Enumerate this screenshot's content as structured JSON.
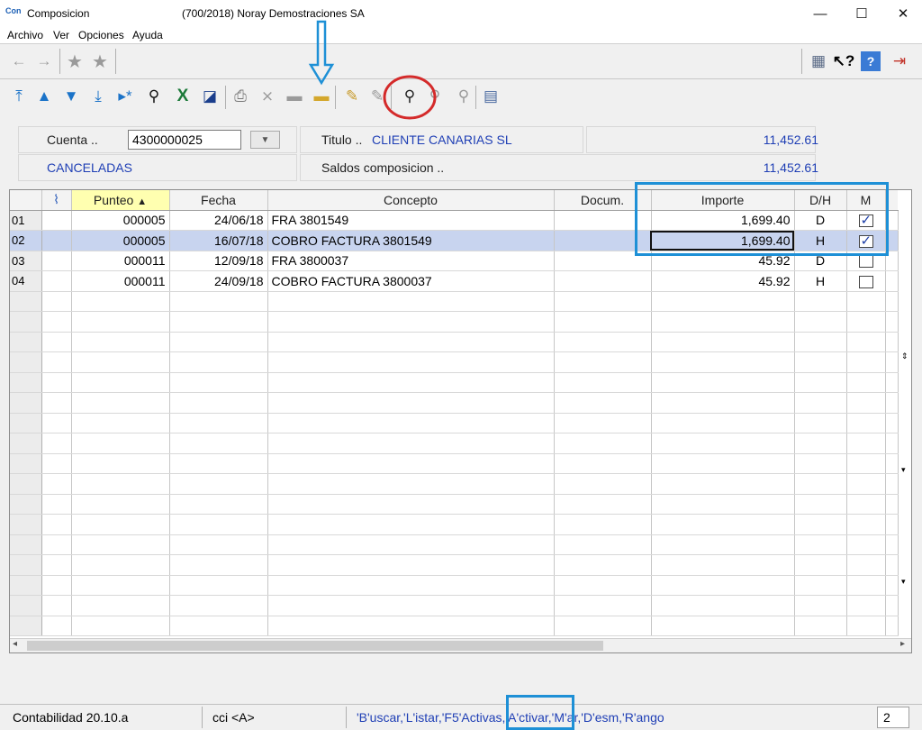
{
  "window": {
    "app_icon": "Con",
    "title": "Composicion",
    "company": "(700/2018) Noray Demostraciones SA",
    "minimize": "—",
    "maximize": "☐",
    "close": "✕"
  },
  "menu": [
    {
      "label": "Archivo"
    },
    {
      "label": "Ver"
    },
    {
      "label": "Opciones"
    },
    {
      "label": "Ayuda"
    }
  ],
  "header": {
    "cuenta_label": "Cuenta ..",
    "cuenta_value": "4300000025",
    "titulo_label": "Titulo ..",
    "titulo_value": "CLIENTE CANARIAS SL",
    "titulo_amount": "11,452.61",
    "estado": "CANCELADAS",
    "saldos_label": "Saldos composicion ..",
    "saldos_amount": "11,452.61"
  },
  "grid": {
    "columns": [
      "",
      "",
      "Punteo",
      "Fecha",
      "Concepto",
      "Docum.",
      "Importe",
      "D/H",
      "M"
    ],
    "sort_indicator": "▲",
    "rows": [
      {
        "num": "01",
        "punteo": "000005",
        "fecha": "24/06/18",
        "concepto": "FRA 3801549",
        "docum": "",
        "importe": "1,699.40",
        "dh": "D",
        "m": true
      },
      {
        "num": "02",
        "punteo": "000005",
        "fecha": "16/07/18",
        "concepto": "COBRO FACTURA 3801549",
        "docum": "",
        "importe": "1,699.40",
        "dh": "H",
        "m": true
      },
      {
        "num": "03",
        "punteo": "000011",
        "fecha": "12/09/18",
        "concepto": "FRA 3800037",
        "docum": "",
        "importe": "45.92",
        "dh": "D",
        "m": false
      },
      {
        "num": "04",
        "punteo": "000011",
        "fecha": "24/09/18",
        "concepto": "COBRO FACTURA 3800037",
        "docum": "",
        "importe": "45.92",
        "dh": "H",
        "m": false
      }
    ],
    "empty_rows": 17,
    "selected_row": 1
  },
  "status": {
    "version": "Contabilidad 20.10.a",
    "user": "cci <A>",
    "hint": "'B'uscar,'L'istar,'F5'Activas,'A'ctivar,'M'ar,'D'esm,'R'ango",
    "count": "2"
  },
  "colors": {
    "accent_blue": "#1f3fb5",
    "highlight_box": "#1e90d6",
    "circle_red": "#d42a2a",
    "selected_row": "#c8d4ef"
  }
}
